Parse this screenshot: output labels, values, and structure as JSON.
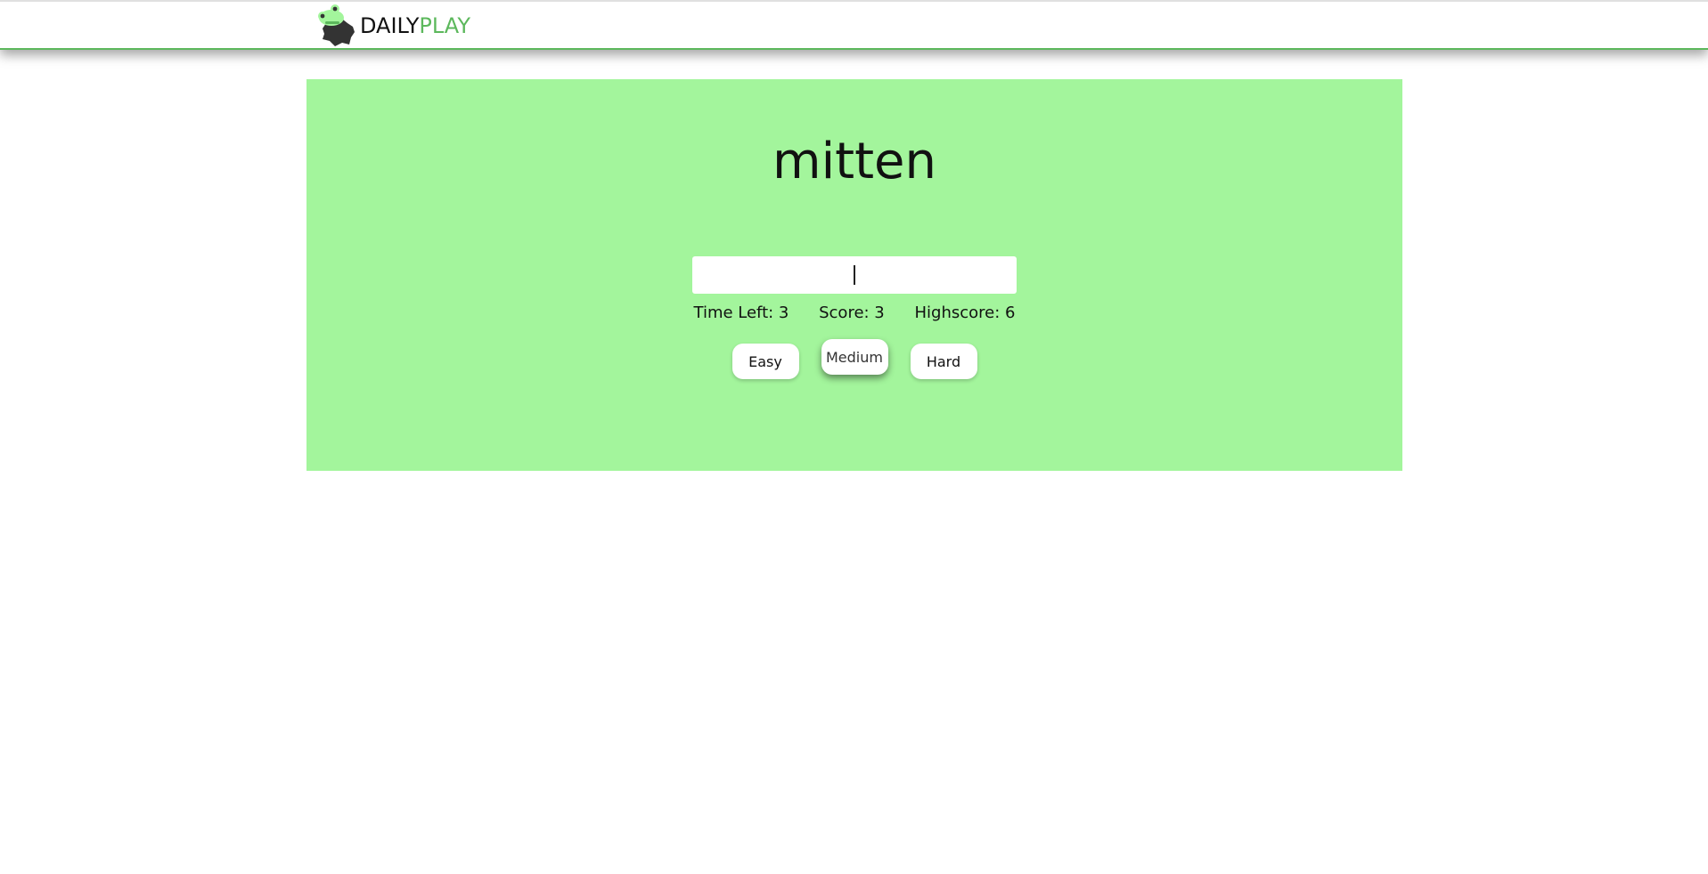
{
  "header": {
    "brand_part1": "DAILY",
    "brand_part2": "PLAY",
    "accent_color": "#5cb85c"
  },
  "game": {
    "word": "mitten",
    "input_value": "",
    "panel_color": "#a3f59c",
    "stats": {
      "time_left": "Time Left: 3",
      "score": "Score: 3",
      "highscore": "Highscore: 6"
    },
    "difficulty": {
      "easy": "Easy",
      "medium": "Medium",
      "hard": "Hard",
      "selected": "medium"
    }
  }
}
